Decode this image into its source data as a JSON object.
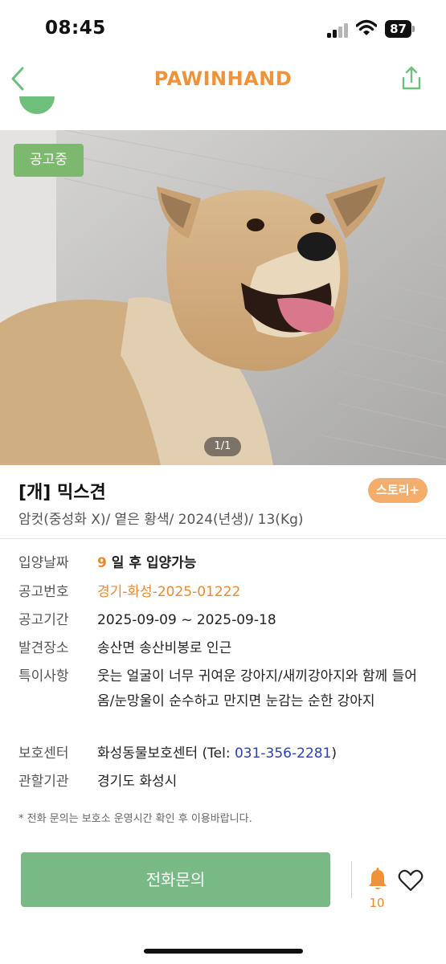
{
  "status_bar": {
    "time": "08:45",
    "battery": "87"
  },
  "header": {
    "logo": "PAWINHAND"
  },
  "photo": {
    "status_chip": "공고중",
    "page_indicator": "1/1"
  },
  "animal": {
    "title": "[개] 믹스견",
    "story_button": "스토리+",
    "subtitle": "암컷(중성화 X)/ 옅은 황색/ 2024(년생)/ 13(Kg)"
  },
  "info": {
    "adoption_date": {
      "label": "입양날짜",
      "days": "9",
      "text": " 일 후 입양가능"
    },
    "notice_number": {
      "label": "공고번호",
      "value": "경기-화성-2025-01222"
    },
    "notice_period": {
      "label": "공고기간",
      "value": "2025-09-09 ~ 2025-09-18"
    },
    "found_place": {
      "label": "발견장소",
      "value": "송산면 송산비봉로 인근"
    },
    "special_notes": {
      "label": "특이사항",
      "value": "웃는 얼굴이 너무 귀여운 강아지/새끼강아지와 함께 들어옴/눈망울이 순수하고 만지면 눈감는 순한 강아지"
    },
    "shelter": {
      "label": "보호센터",
      "name": "화성동물보호센터 (Tel: ",
      "tel": "031-356-2281",
      "close": ")"
    },
    "authority": {
      "label": "관할기관",
      "value": "경기도 화성시"
    }
  },
  "notice": "* 전화 문의는 보호소 운영시간 확인 후 이용바랍니다.",
  "bottom_bar": {
    "call_button": "전화문의",
    "bell_count": "10"
  },
  "colors": {
    "brand": "#f0923a",
    "green": "#79b986",
    "link": "#2a40b8"
  },
  "icons": [
    "signal-icon",
    "wifi-icon",
    "battery-icon",
    "back-icon",
    "share-icon",
    "bell-icon",
    "heart-icon"
  ]
}
